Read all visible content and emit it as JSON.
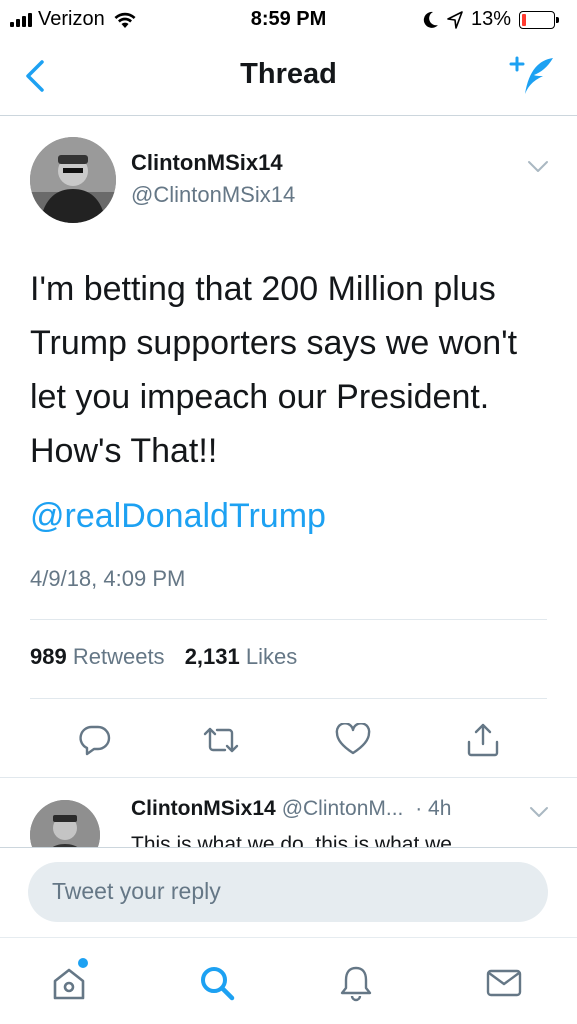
{
  "status_bar": {
    "carrier": "Verizon",
    "time": "8:59 PM",
    "battery": "13%",
    "battery_level": 0.13,
    "icons": [
      "signal-icon",
      "wifi-icon",
      "moon-icon",
      "location-arrow-icon",
      "battery-icon"
    ]
  },
  "nav": {
    "title": "Thread",
    "icons": [
      "back-chevron-icon",
      "compose-tweet-icon"
    ]
  },
  "tweet": {
    "author_name": "ClintonMSix14",
    "author_handle": "@ClintonMSix14",
    "text_lines": [
      "I'm betting that 200 Million plus",
      "Trump supporters says we won't",
      "let you impeach our President.",
      "How's That!!"
    ],
    "mention": "@realDonaldTrump",
    "timestamp": "4/9/18, 4:09 PM",
    "retweets_count": "989",
    "retweets_label": "Retweets",
    "likes_count": "2,131",
    "likes_label": "Likes",
    "action_icons": [
      "reply-icon",
      "retweet-icon",
      "like-heart-icon",
      "share-icon"
    ]
  },
  "reply_tweet": {
    "author_name": "ClintonMSix14",
    "author_handle": "@ClintonM...",
    "time": "· 4h",
    "text_preview": "This is what we do, this is what we"
  },
  "reply_bar": {
    "placeholder": "Tweet your reply"
  },
  "tab_bar": {
    "icons": [
      "home-icon",
      "search-icon",
      "notifications-bell-icon",
      "messages-envelope-icon"
    ]
  },
  "colors": {
    "accent": "#1da1f2",
    "text": "#14171a",
    "secondary": "#657786",
    "divider": "#e1e8ed",
    "battery_low": "#ff3b30"
  }
}
